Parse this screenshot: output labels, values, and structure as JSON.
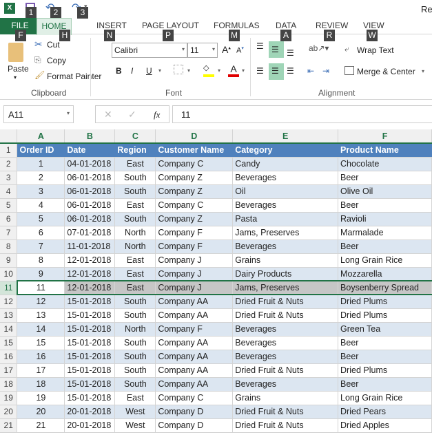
{
  "qat": {
    "title_partial": "Re",
    "keys": [
      "1",
      "2",
      "3"
    ]
  },
  "tabs": [
    {
      "label": "FILE",
      "key": "F"
    },
    {
      "label": "HOME",
      "key": "H"
    },
    {
      "label": "INSERT",
      "key": "N"
    },
    {
      "label": "PAGE LAYOUT",
      "key": "P"
    },
    {
      "label": "FORMULAS",
      "key": "M"
    },
    {
      "label": "DATA",
      "key": "A"
    },
    {
      "label": "REVIEW",
      "key": "R"
    },
    {
      "label": "VIEW",
      "key": "W"
    }
  ],
  "clipboard": {
    "paste": "Paste",
    "cut": "Cut",
    "copy": "Copy",
    "format_painter": "Format Painter",
    "group": "Clipboard"
  },
  "font": {
    "name": "Calibri",
    "size": "11",
    "bold": "B",
    "italic": "I",
    "underline": "U",
    "group": "Font"
  },
  "alignment": {
    "wrap": "Wrap Text",
    "merge": "Merge & Center",
    "group": "Alignment"
  },
  "formula_bar": {
    "name_box": "A11",
    "value": "11",
    "fx": "fx"
  },
  "colors": {
    "accent": "#217346",
    "header": "#4f81bd",
    "band": "#dce6f1"
  },
  "columns": [
    "A",
    "B",
    "C",
    "D",
    "E",
    "F"
  ],
  "headers": [
    "Order ID",
    "Date",
    "Region",
    "Customer Name",
    "Category",
    "Product Name"
  ],
  "selected_row": 11,
  "rows": [
    [
      "1",
      "04-01-2018",
      "East",
      "Company C",
      "Candy",
      "Chocolate"
    ],
    [
      "2",
      "06-01-2018",
      "South",
      "Company Z",
      "Beverages",
      "Beer"
    ],
    [
      "3",
      "06-01-2018",
      "South",
      "Company Z",
      "Oil",
      "Olive Oil"
    ],
    [
      "4",
      "06-01-2018",
      "East",
      "Company C",
      "Beverages",
      "Beer"
    ],
    [
      "5",
      "06-01-2018",
      "South",
      "Company Z",
      "Pasta",
      "Ravioli"
    ],
    [
      "6",
      "07-01-2018",
      "North",
      "Company F",
      "Jams, Preserves",
      "Marmalade"
    ],
    [
      "7",
      "11-01-2018",
      "North",
      "Company F",
      "Beverages",
      "Beer"
    ],
    [
      "8",
      "12-01-2018",
      "East",
      "Company J",
      "Grains",
      "Long Grain Rice"
    ],
    [
      "9",
      "12-01-2018",
      "East",
      "Company J",
      "Dairy Products",
      "Mozzarella"
    ],
    [
      "11",
      "12-01-2018",
      "East",
      "Company J",
      "Jams, Preserves",
      "Boysenberry Spread"
    ],
    [
      "12",
      "15-01-2018",
      "South",
      "Company AA",
      "Dried Fruit & Nuts",
      "Dried Plums"
    ],
    [
      "13",
      "15-01-2018",
      "South",
      "Company AA",
      "Dried Fruit & Nuts",
      "Dried Plums"
    ],
    [
      "14",
      "15-01-2018",
      "North",
      "Company F",
      "Beverages",
      "Green Tea"
    ],
    [
      "15",
      "15-01-2018",
      "South",
      "Company AA",
      "Beverages",
      "Beer"
    ],
    [
      "16",
      "15-01-2018",
      "South",
      "Company AA",
      "Beverages",
      "Beer"
    ],
    [
      "17",
      "15-01-2018",
      "South",
      "Company AA",
      "Dried Fruit & Nuts",
      "Dried Plums"
    ],
    [
      "18",
      "15-01-2018",
      "South",
      "Company AA",
      "Beverages",
      "Beer"
    ],
    [
      "19",
      "15-01-2018",
      "East",
      "Company C",
      "Grains",
      "Long Grain Rice"
    ],
    [
      "20",
      "20-01-2018",
      "West",
      "Company D",
      "Dried Fruit & Nuts",
      "Dried Pears"
    ],
    [
      "21",
      "20-01-2018",
      "West",
      "Company D",
      "Dried Fruit & Nuts",
      "Dried Apples"
    ]
  ]
}
